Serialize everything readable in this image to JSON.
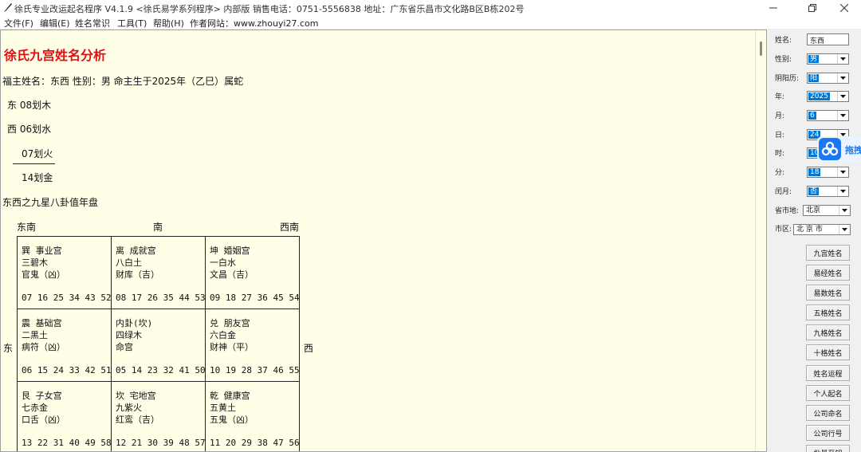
{
  "window": {
    "title": "徐氏专业改运起名程序 V4.1.9 <徐氏易学系列程序> 内部版  销售电话：0751-5556838   地址：广东省乐昌市文化路B区B栋202号"
  },
  "menu": [
    "文件(F)",
    "编辑(E)",
    "姓名常识",
    "工具(T)",
    "帮助(H)",
    "作者网站：www.zhouyi27.com"
  ],
  "report": {
    "heading": "徐氏九宫姓名分析",
    "summary": "福主姓名：东西   性别：男   命主生于2025年（乙巳）属蛇",
    "strokes": [
      "东 08划木",
      "西 06划水",
      "07划火",
      "14划金"
    ],
    "subtitle": "东西之九星八卦值年盘",
    "directions": {
      "se": "东南",
      "s": "南",
      "sw": "西南",
      "e": "东",
      "w": "西"
    },
    "palaces": [
      {
        "name": "巽 事业宫",
        "star": "三碧木",
        "luck": "官鬼（凶）",
        "nums": "07 16 25 34 43 52"
      },
      {
        "name": "离 成就宫",
        "star": "八白土",
        "luck": "财库（吉）",
        "nums": "08 17 26 35 44 53"
      },
      {
        "name": "坤 婚姻宫",
        "star": "一白水",
        "luck": "文昌（吉）",
        "nums": "09 18 27 36 45 54"
      },
      {
        "name": "震 基础宫",
        "star": "二黑土",
        "luck": "病符（凶）",
        "nums": "06 15 24 33 42 51"
      },
      {
        "name": "内卦(坎)",
        "star": "四绿木",
        "luck": "命宫",
        "nums": "05 14 23 32 41 50"
      },
      {
        "name": "兑 朋友宫",
        "star": "六白金",
        "luck": "财神（平）",
        "nums": "10 19 28 37 46 55"
      },
      {
        "name": "艮 子女宫",
        "star": "七赤金",
        "luck": "口舌（凶）",
        "nums": "13 22 31 40 49 58"
      },
      {
        "name": "坎 宅地宫",
        "star": "九紫火",
        "luck": "红鸾（吉）",
        "nums": "12 21 30 39 48 57"
      },
      {
        "name": "乾 健康宫",
        "star": "五黄土",
        "luck": "五鬼（凶）",
        "nums": "11 20 29 38 47 56"
      }
    ]
  },
  "panel": {
    "name_label": "姓名:",
    "name_value": "东西",
    "gender_label": "性别:",
    "gender_value": "男",
    "calendar_label": "阴阳历:",
    "calendar_value": "阳",
    "year_label": "年:",
    "year_value": "2025",
    "month_label": "月:",
    "month_value": "6",
    "day_label": "日:",
    "day_value": "24",
    "hour_label": "时:",
    "hour_value": "10",
    "minute_label": "分:",
    "minute_value": "18",
    "leap_label": "闰月:",
    "leap_value": "否",
    "province_label": "省市地:",
    "province_value": "北京",
    "city_label": "市区:",
    "city_value": "北 京 市",
    "buttons": [
      "九宫姓名",
      "易经姓名",
      "易数姓名",
      "五格姓名",
      "九格姓名",
      "十格姓名",
      "姓名运程",
      "个人起名",
      "公司命名",
      "公司行号",
      "批量至钥"
    ]
  },
  "float_widget": {
    "label": "拖拽"
  }
}
